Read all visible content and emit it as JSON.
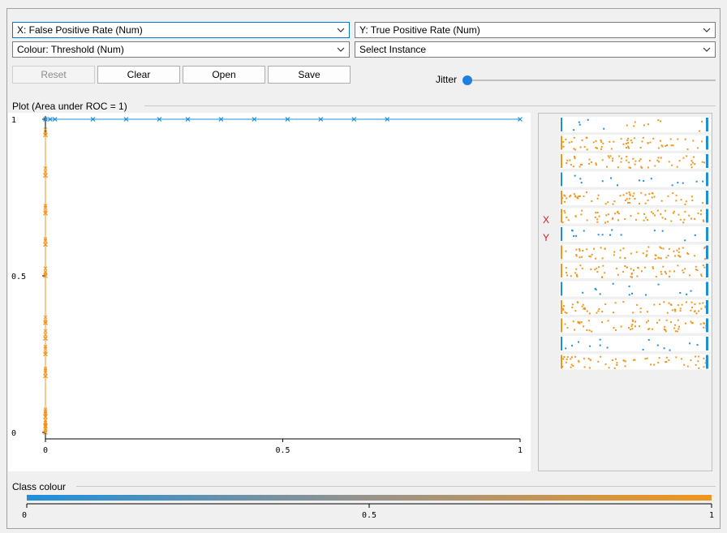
{
  "controls": {
    "x_axis": "X: False Positive Rate (Num)",
    "y_axis": "Y: True Positive Rate (Num)",
    "colour": "Colour: Threshold (Num)",
    "instance": "Select Instance",
    "reset": "Reset",
    "clear": "Clear",
    "open": "Open",
    "save": "Save",
    "jitter_label": "Jitter",
    "jitter_value": 0
  },
  "plot": {
    "title": "Plot (Area under ROC = 1)",
    "x_ticks": [
      "0",
      "0.5",
      "1"
    ],
    "y_ticks": [
      "1",
      "0.5",
      "0"
    ]
  },
  "side_panel": {
    "x_marker": "X",
    "y_marker": "Y"
  },
  "class_colour": {
    "label": "Class colour",
    "ticks": [
      "0",
      "0.5",
      "1"
    ],
    "start_color": "#1f8fdc",
    "end_color": "#f0961e"
  },
  "colors": {
    "blue": "#1f8fdc",
    "orange": "#f0961e",
    "focus": "#0078d7",
    "marker_red": "#d02020"
  },
  "chart_data": {
    "type": "line",
    "title": "Plot (Area under ROC = 1)",
    "xlabel": "",
    "ylabel": "",
    "xlim": [
      0,
      1
    ],
    "ylim": [
      0,
      1
    ],
    "x_ticks": [
      0,
      0.5,
      1
    ],
    "y_ticks": [
      0,
      0.5,
      1
    ],
    "grid": false,
    "series": [
      {
        "color": "#f0961e",
        "x": [
          0,
          0,
          0,
          0,
          0,
          0,
          0,
          0,
          0,
          0,
          0,
          0
        ],
        "y": [
          0,
          0.02,
          0.05,
          0.18,
          0.25,
          0.3,
          0.35,
          0.5,
          0.6,
          0.7,
          0.82,
          0.95
        ]
      },
      {
        "color": "#1f8fdc",
        "x": [
          0,
          0.01,
          0.02,
          0.1,
          0.17,
          0.24,
          0.3,
          0.37,
          0.44,
          0.51,
          0.58,
          0.65,
          0.72,
          1
        ],
        "y": [
          1,
          1,
          1,
          1,
          1,
          1,
          1,
          1,
          1,
          1,
          1,
          1,
          1,
          1
        ]
      }
    ]
  }
}
